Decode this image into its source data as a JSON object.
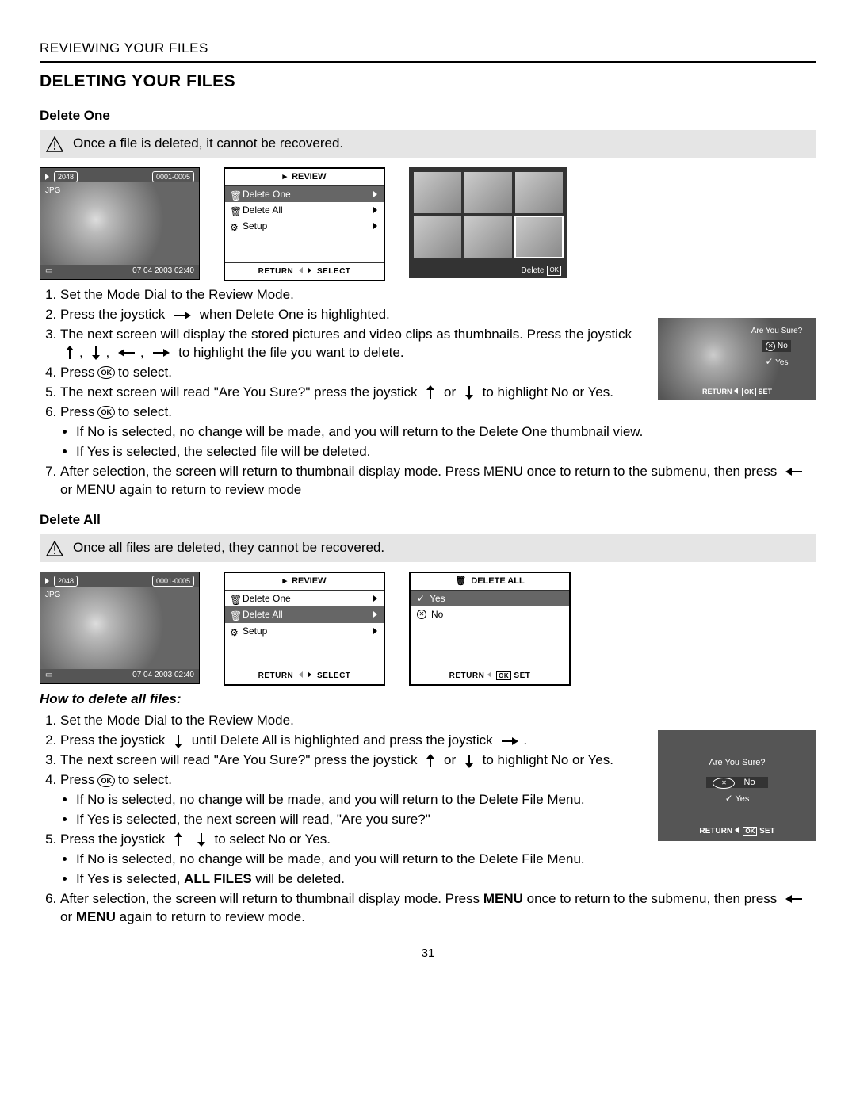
{
  "header": "REVIEWING YOUR FILES",
  "title": "DELETING YOUR FILES",
  "pagenum": "31",
  "deleteOne": {
    "heading": "Delete One",
    "warning": "Once a file is deleted, it cannot be recovered.",
    "lcd": {
      "res": "2048",
      "counter": "0001-0005",
      "ext": "JPG",
      "date": "07  04  2003  02:40"
    },
    "menu": {
      "title": "REVIEW",
      "items": [
        "Delete One",
        "Delete All",
        "Setup"
      ],
      "footL": "RETURN",
      "footR": "SELECT"
    },
    "thumbs": {
      "del": "Delete",
      "ok": "OK"
    },
    "confirm": {
      "q": "Are You Sure?",
      "no": "No",
      "yes": "Yes",
      "ret": "RETURN",
      "set": "SET",
      "ok": "OK"
    },
    "steps": {
      "s1": "Set the Mode Dial to the Review Mode.",
      "s2a": "Press the joystick",
      "s2b": "when Delete One is highlighted.",
      "s3a": "The next screen will display the stored pictures and video clips as thumbnails.  Press the joystick",
      "s3b": "to highlight the file you want to delete.",
      "s4a": "Press",
      "s4b": "to select.",
      "s5a": "The next screen will read \"Are You Sure?\" press the joystick",
      "s5b": "or",
      "s5c": "to highlight No or Yes.",
      "s6a": "Press",
      "s6b": "to select.",
      "s6_1": "If No is selected, no change will be made, and you will return to the Delete One thumbnail view.",
      "s6_2": "If Yes is selected, the selected file will be deleted.",
      "s7a": "After selection, the screen will return to thumbnail display mode. Press MENU once to return to the submenu, then press",
      "s7b": "or MENU again to return to review mode"
    }
  },
  "deleteAll": {
    "heading": "Delete All",
    "warning": "Once all files are deleted, they cannot be recovered.",
    "howto": "How to delete all files:",
    "lcd": {
      "res": "2048",
      "counter": "0001-0005",
      "ext": "JPG",
      "date": "07  04  2003  02:40"
    },
    "menu": {
      "title": "REVIEW",
      "items": [
        "Delete One",
        "Delete All",
        "Setup"
      ],
      "footL": "RETURN",
      "footR": "SELECT"
    },
    "dall": {
      "title": "DELETE ALL",
      "yes": "Yes",
      "no": "No",
      "footL": "RETURN",
      "footR": "SET",
      "ok": "OK"
    },
    "sure": {
      "q": "Are You Sure?",
      "no": "No",
      "yes": "Yes",
      "ret": "RETURN",
      "set": "SET",
      "ok": "OK"
    },
    "steps": {
      "s1": "Set the Mode Dial to the Review Mode.",
      "s2a": "Press the joystick",
      "s2b": "until Delete All is highlighted and press the joystick",
      "s2c": ".",
      "s3a": "The next screen will read \"Are You Sure?\" press the joystick",
      "s3b": "or",
      "s3c": "to highlight No or Yes.",
      "s4a": "Press",
      "s4b": "to select.",
      "s4_1": "If No is selected, no change will be made, and you will return to the Delete File Menu.",
      "s4_2": "If Yes is selected, the next screen will read, \"Are you sure?\"",
      "s5a": "Press the joystick",
      "s5b": "to select No or Yes.",
      "s5_1": "If No is selected, no change will be made, and you will return to the Delete File Menu.",
      "s5_2a": "If Yes is selected, ",
      "s5_2b": "ALL FILES",
      "s5_2c": " will be deleted.",
      "s6a": "After selection, the screen will return to thumbnail display mode. Press ",
      "s6m": "MENU",
      "s6b": " once to return to the submenu, then press",
      "s6c": "or ",
      "s6m2": "MENU",
      "s6d": " again to return to review mode."
    }
  }
}
